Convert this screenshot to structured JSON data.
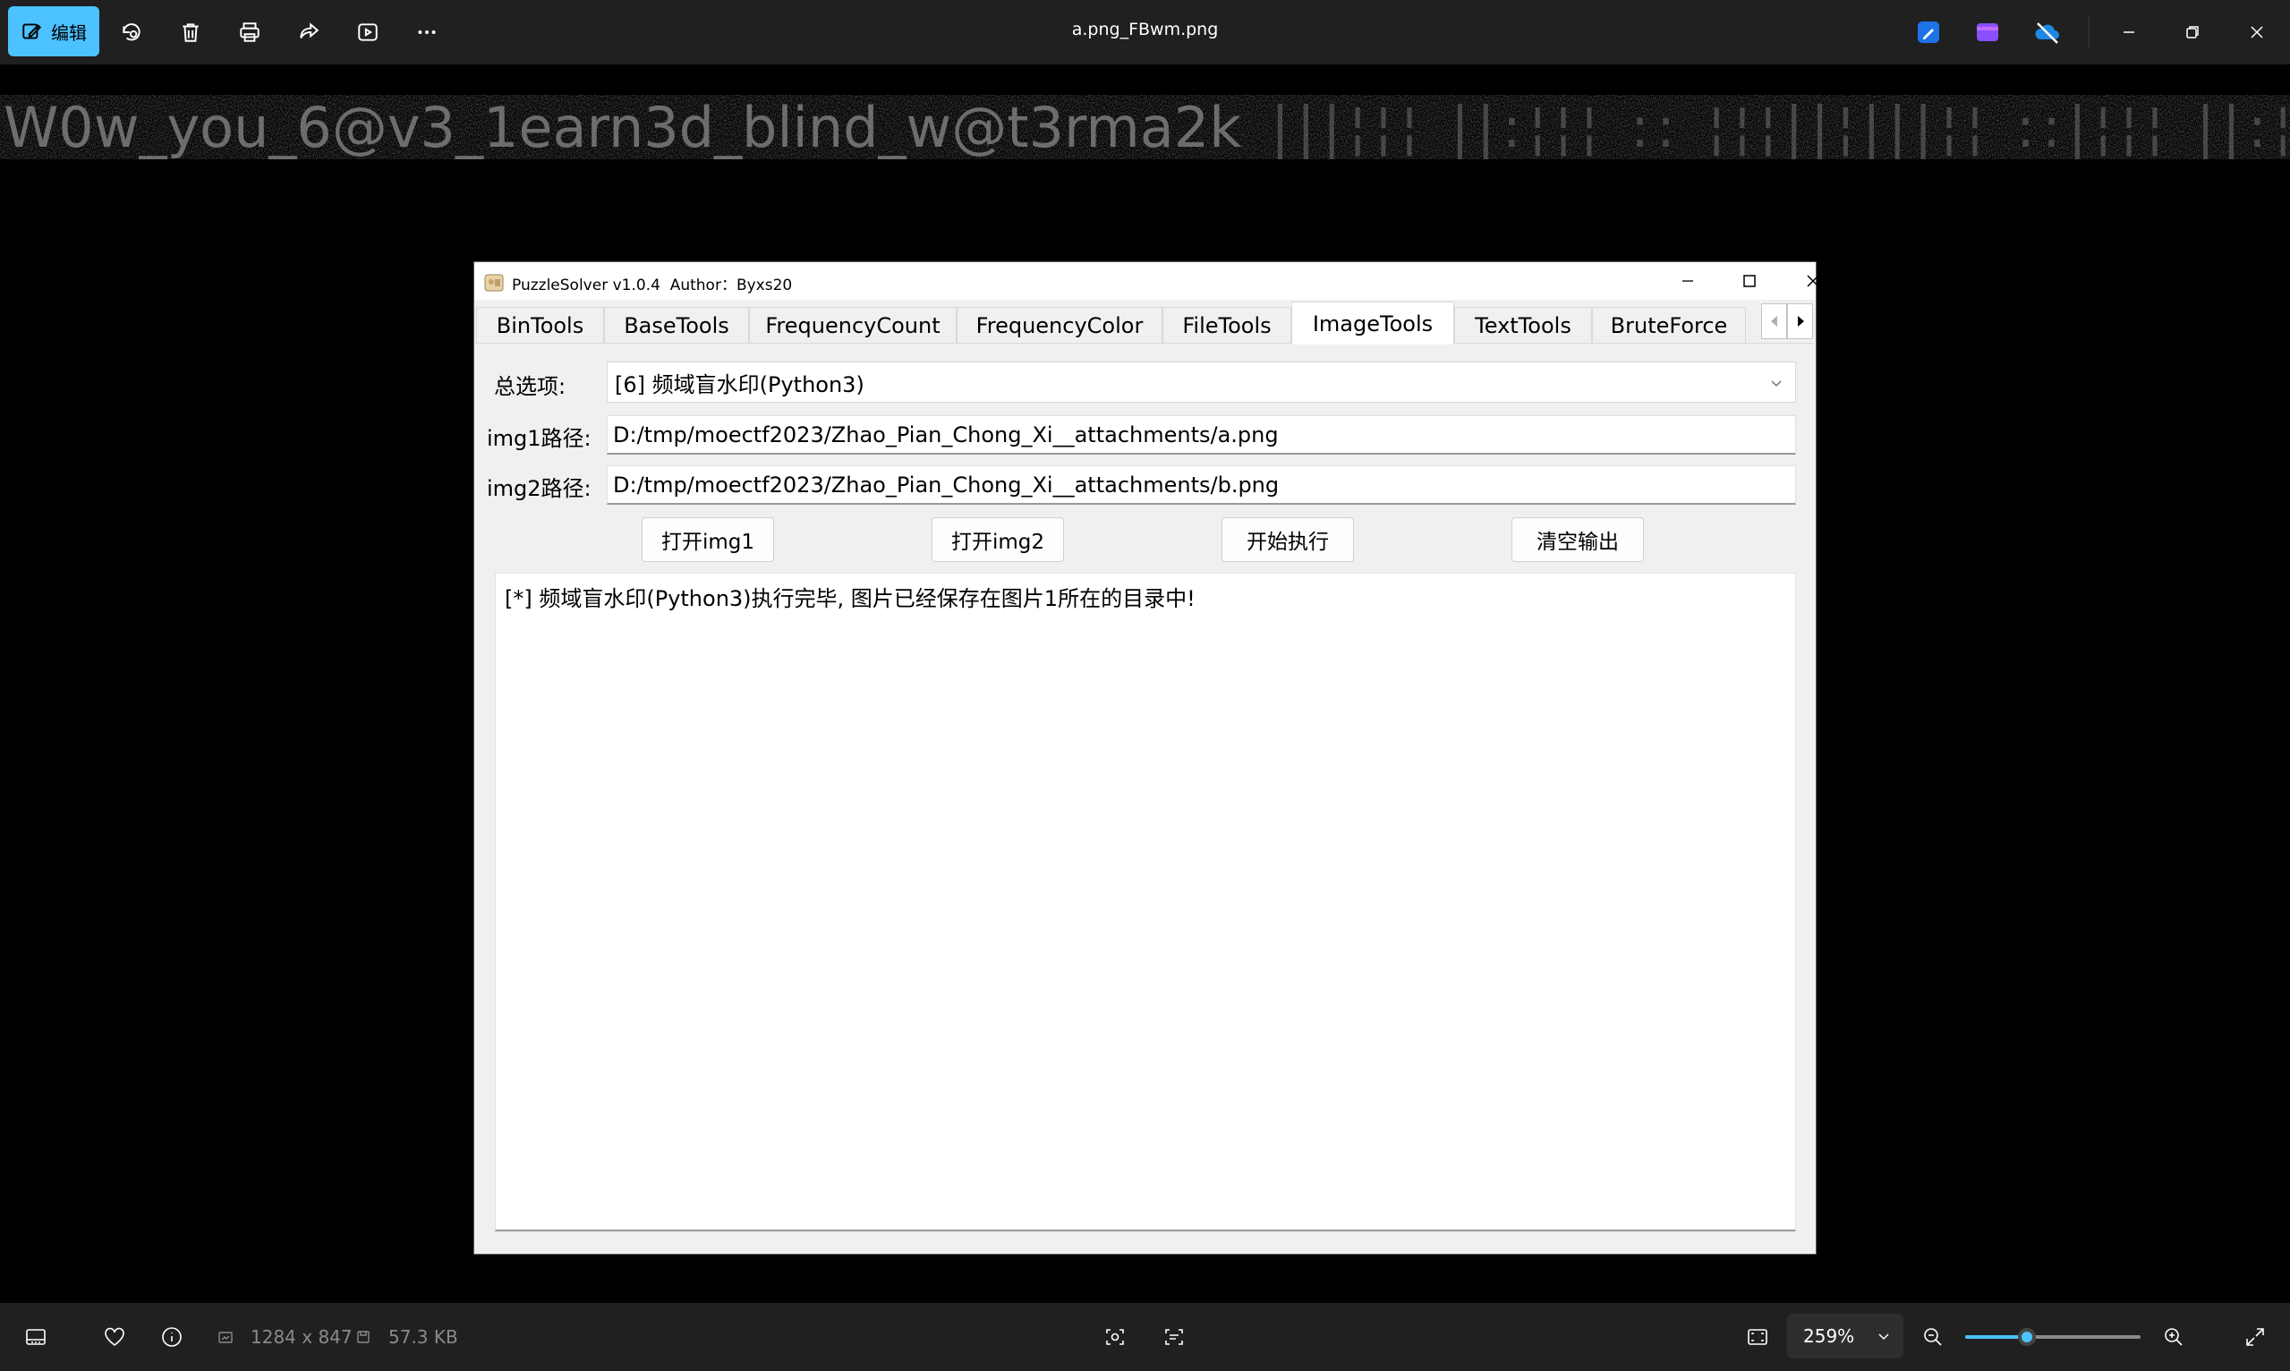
{
  "viewer": {
    "edit_label": "编辑",
    "file_title": "a.png_FBwm.png",
    "watermark_text": "W0w_you_6@v3_1earn3d_blind_w@t3rma2k",
    "info": {
      "dimensions": "1284 x 847",
      "file_size": "57.3 KB"
    },
    "zoom": {
      "label": "259%",
      "slider_fraction": 0.35
    }
  },
  "app": {
    "title": "PuzzleSolver v1.0.4  Author：Byxs20",
    "tabs": [
      {
        "label": "BinTools",
        "active": false
      },
      {
        "label": "BaseTools",
        "active": false
      },
      {
        "label": "FrequencyCount",
        "active": false
      },
      {
        "label": "FrequencyColor",
        "active": false
      },
      {
        "label": "FileTools",
        "active": false
      },
      {
        "label": "ImageTools",
        "active": true
      },
      {
        "label": "TextTools",
        "active": false
      },
      {
        "label": "BruteForce",
        "active": false
      }
    ],
    "options_label": "总选项:",
    "options_value": "[6] 频域盲水印(Python3)",
    "img1_label": "img1路径:",
    "img1_value": "D:/tmp/moectf2023/Zhao_Pian_Chong_Xi__attachments/a.png",
    "img2_label": "img2路径:",
    "img2_value": "D:/tmp/moectf2023/Zhao_Pian_Chong_Xi__attachments/b.png",
    "buttons": {
      "open_img1": "打开img1",
      "open_img2": "打开img2",
      "start": "开始执行",
      "clear": "清空输出"
    },
    "output_text": "[*] 频域盲水印(Python3)执行完毕, 图片已经保存在图片1所在的目录中!"
  },
  "colors": {
    "accent": "#4cc2ff",
    "chrome": "#202020"
  }
}
